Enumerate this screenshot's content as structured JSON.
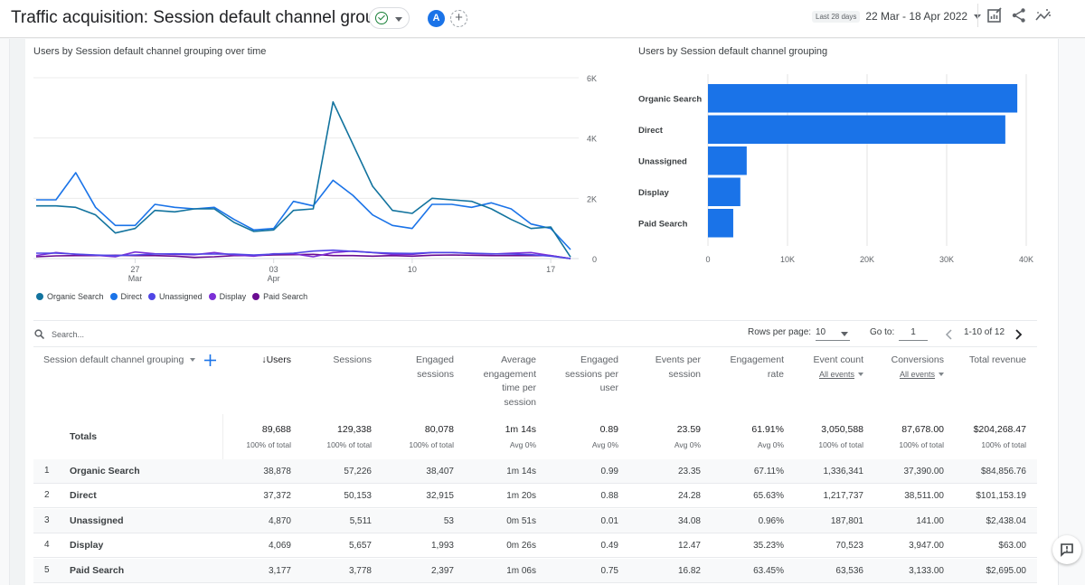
{
  "header": {
    "title": "Traffic acquisition: Session default channel grouping",
    "status_icon": "check-circle-icon",
    "comparison_avatar": "A",
    "add_comparison_icon": "plus-circle-icon",
    "date_chip": "Last 28 days",
    "date_range": "22 Mar - 18 Apr 2022",
    "toolbar_icons": [
      "customize-report-icon",
      "share-icon",
      "insights-icon"
    ]
  },
  "colors": {
    "organic_search": "#12739e",
    "direct": "#1a73e8",
    "unassigned": "#4f46e5",
    "display": "#7b2fd6",
    "paid_search": "#6a0d91",
    "bar": "#1a73e8",
    "accent": "#1a73e8"
  },
  "chart_data": [
    {
      "type": "line",
      "title": "Users by Session default channel grouping over time",
      "xlabel": "",
      "ylabel": "",
      "x": [
        "22 Mar",
        "23 Mar",
        "24 Mar",
        "25 Mar",
        "26 Mar",
        "27 Mar",
        "28 Mar",
        "29 Mar",
        "30 Mar",
        "31 Mar",
        "01 Apr",
        "02 Apr",
        "03 Apr",
        "04 Apr",
        "05 Apr",
        "06 Apr",
        "07 Apr",
        "08 Apr",
        "09 Apr",
        "10 Apr",
        "11 Apr",
        "12 Apr",
        "13 Apr",
        "14 Apr",
        "15 Apr",
        "16 Apr",
        "17 Apr",
        "18 Apr"
      ],
      "x_ticks": [
        {
          "label": "27",
          "sublabel": "Mar",
          "index": 5
        },
        {
          "label": "03",
          "sublabel": "Apr",
          "index": 12
        },
        {
          "label": "10",
          "sublabel": "",
          "index": 19
        },
        {
          "label": "17",
          "sublabel": "",
          "index": 26
        }
      ],
      "y_ticks": [
        "0",
        "2K",
        "4K",
        "6K"
      ],
      "ylim": [
        0,
        6000
      ],
      "y_axis_side": "right",
      "grid": true,
      "legend_position": "bottom-left",
      "series": [
        {
          "name": "Organic Search",
          "color_key": "organic_search",
          "values": [
            1750,
            1750,
            1700,
            1450,
            850,
            1000,
            1600,
            1550,
            1650,
            1650,
            1200,
            900,
            950,
            1600,
            1650,
            5200,
            3800,
            2400,
            1600,
            1500,
            2000,
            1950,
            1900,
            1650,
            1300,
            1000,
            1050,
            50
          ]
        },
        {
          "name": "Direct",
          "color_key": "direct",
          "values": [
            1950,
            1950,
            2850,
            1700,
            1100,
            1100,
            1800,
            1700,
            1650,
            1700,
            1300,
            950,
            1000,
            1900,
            1750,
            2600,
            2100,
            1450,
            1100,
            1000,
            1800,
            1800,
            1700,
            1850,
            1650,
            1150,
            1000,
            300
          ]
        },
        {
          "name": "Unassigned",
          "color_key": "unassigned",
          "values": [
            180,
            180,
            150,
            120,
            100,
            120,
            150,
            160,
            150,
            150,
            150,
            120,
            150,
            180,
            250,
            280,
            240,
            200,
            180,
            170,
            200,
            200,
            180,
            160,
            150,
            130,
            80,
            0
          ]
        },
        {
          "name": "Display",
          "color_key": "display",
          "values": [
            100,
            200,
            140,
            110,
            60,
            220,
            160,
            140,
            130,
            200,
            120,
            80,
            160,
            160,
            60,
            200,
            250,
            200,
            140,
            140,
            200,
            200,
            170,
            150,
            180,
            200,
            100,
            0
          ]
        },
        {
          "name": "Paid Search",
          "color_key": "paid_search",
          "values": [
            60,
            90,
            100,
            100,
            110,
            100,
            100,
            80,
            40,
            60,
            100,
            100,
            120,
            130,
            140,
            100,
            100,
            80,
            100,
            80,
            110,
            120,
            110,
            100,
            100,
            100,
            100,
            0
          ]
        }
      ]
    },
    {
      "type": "bar",
      "orientation": "horizontal",
      "title": "Users by Session default channel grouping",
      "categories": [
        "Organic Search",
        "Direct",
        "Unassigned",
        "Display",
        "Paid Search"
      ],
      "values": [
        38878,
        37372,
        4870,
        4069,
        3177
      ],
      "x_ticks": [
        "0",
        "10K",
        "20K",
        "30K",
        "40K"
      ],
      "xlim": [
        0,
        40000
      ],
      "grid": true,
      "xlabel": "",
      "ylabel": ""
    }
  ],
  "table": {
    "search_placeholder": "Search...",
    "rows_per_page_label": "Rows per page:",
    "rows_per_page_value": "10",
    "goto_label": "Go to:",
    "goto_value": "1",
    "page_range": "1-10 of 12",
    "dimension_header": "Session default channel grouping",
    "add_dimension_icon": "plus-icon",
    "columns": [
      {
        "label": "↓Users",
        "sub": ""
      },
      {
        "label": "Sessions",
        "sub": ""
      },
      {
        "label": "Engaged sessions",
        "sub": ""
      },
      {
        "label": "Average engagement time per session",
        "sub": ""
      },
      {
        "label": "Engaged sessions per user",
        "sub": ""
      },
      {
        "label": "Events per session",
        "sub": ""
      },
      {
        "label": "Engagement rate",
        "sub": ""
      },
      {
        "label": "Event count",
        "sub": "All events"
      },
      {
        "label": "Conversions",
        "sub": "All events"
      },
      {
        "label": "Total revenue",
        "sub": ""
      }
    ],
    "totals_label": "Totals",
    "totals": [
      {
        "value": "89,688",
        "sub": "100% of total"
      },
      {
        "value": "129,338",
        "sub": "100% of total"
      },
      {
        "value": "80,078",
        "sub": "100% of total"
      },
      {
        "value": "1m 14s",
        "sub": "Avg 0%"
      },
      {
        "value": "0.89",
        "sub": "Avg 0%"
      },
      {
        "value": "23.59",
        "sub": "Avg 0%"
      },
      {
        "value": "61.91%",
        "sub": "Avg 0%"
      },
      {
        "value": "3,050,588",
        "sub": "100% of total"
      },
      {
        "value": "87,678.00",
        "sub": "100% of total"
      },
      {
        "value": "$204,268.47",
        "sub": "100% of total"
      }
    ],
    "rows": [
      {
        "num": "1",
        "name": "Organic Search",
        "cells": [
          "38,878",
          "57,226",
          "38,407",
          "1m 14s",
          "0.99",
          "23.35",
          "67.11%",
          "1,336,341",
          "37,390.00",
          "$84,856.76"
        ]
      },
      {
        "num": "2",
        "name": "Direct",
        "cells": [
          "37,372",
          "50,153",
          "32,915",
          "1m 20s",
          "0.88",
          "24.28",
          "65.63%",
          "1,217,737",
          "38,511.00",
          "$101,153.19"
        ]
      },
      {
        "num": "3",
        "name": "Unassigned",
        "cells": [
          "4,870",
          "5,511",
          "53",
          "0m 51s",
          "0.01",
          "34.08",
          "0.96%",
          "187,801",
          "141.00",
          "$2,438.04"
        ]
      },
      {
        "num": "4",
        "name": "Display",
        "cells": [
          "4,069",
          "5,657",
          "1,993",
          "0m 26s",
          "0.49",
          "12.47",
          "35.23%",
          "70,523",
          "3,947.00",
          "$63.00"
        ]
      },
      {
        "num": "5",
        "name": "Paid Search",
        "cells": [
          "3,177",
          "3,778",
          "2,397",
          "1m 06s",
          "0.75",
          "16.82",
          "63.45%",
          "63,536",
          "3,133.00",
          "$2,695.00"
        ]
      }
    ]
  },
  "feedback_icon": "feedback-icon"
}
